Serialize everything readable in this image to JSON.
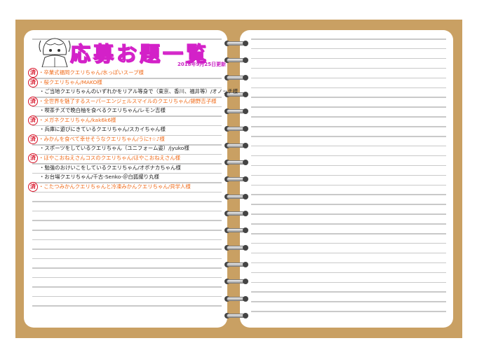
{
  "header": {
    "title": "応募お題一覧",
    "updated": "2018年9月25日更新"
  },
  "stamp_label": "済",
  "entries": [
    {
      "text": "・卒業式福岡クエリちゃん/水っぽいスープ様",
      "done": true
    },
    {
      "text": "・桜クエリちゃん/MAKO様",
      "done": true
    },
    {
      "text": "・ご当地クエリちゃんのいずれかをリアル等身で（東京、香川、福井等）/オノッチ様",
      "done": false
    },
    {
      "text": "・全世界を魅了するスーパーエンジェルスマイルのクエリちゃん/錦野吉子様",
      "done": true
    },
    {
      "text": "・喫茶チズで晩白柚を食べるクエリちゃん/レモン吉様",
      "done": false
    },
    {
      "text": "・メガネクエリちゃん/kak6k6様",
      "done": true
    },
    {
      "text": "・兵庫に遊びにきているクエリちゃん/スカイちゃん様",
      "done": false
    },
    {
      "text": "・みかんを食べて幸せそうなクエリちゃん/うに†☆♪様",
      "done": true
    },
    {
      "text": "・スポーツをしているクエリちゃん（ユニフォーム姿）/jyuko様",
      "done": false
    },
    {
      "text": "・ほやこおねえさんコスのクエリちゃん/ほやこおねえさん様",
      "done": true
    },
    {
      "text": "・勉強のおけいこをしているクエリちゃん/オボナカちゃん様",
      "done": false
    },
    {
      "text": "・お台場クエリちゃん/千古-Senko-＠白狐撮り丸様",
      "done": false
    },
    {
      "text": "・こたつみかんクエリちゃんと冷凍みかんクエリちゃん/貝学人様",
      "done": true
    }
  ],
  "colors": {
    "board": "#c9a063",
    "title_stroke": "#d321c8",
    "done_text": "#f06b1a",
    "stamp": "#d8152a"
  },
  "icons": [
    "girl-mascot-icon",
    "binder-ring-icon",
    "completed-stamp-icon"
  ]
}
